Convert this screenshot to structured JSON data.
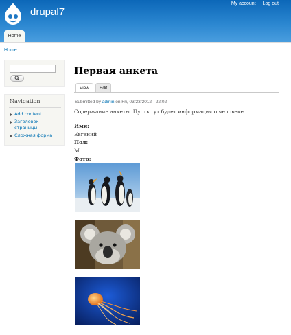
{
  "header": {
    "site_name": "drupal7",
    "secondary_menu": {
      "my_account": "My account",
      "log_out": "Log out"
    },
    "main_menu": {
      "home": "Home"
    },
    "logo_icon": "drupal-drop-icon"
  },
  "breadcrumb": {
    "home": "Home"
  },
  "sidebar": {
    "search": {
      "value": "",
      "button_icon": "magnifier-icon"
    },
    "navigation": {
      "title": "Navigation",
      "items": [
        {
          "label": "Add content"
        },
        {
          "label": "Заголовок страницы"
        },
        {
          "label": "Сложная форма"
        }
      ]
    }
  },
  "node": {
    "title": "Первая анкета",
    "tabs": [
      {
        "label": "View",
        "active": true
      },
      {
        "label": "Edit",
        "active": false
      }
    ],
    "submitted": {
      "prefix": "Submitted by ",
      "author": "admin",
      "suffix": " on Fri, 03/23/2012 - 22:02"
    },
    "body": "Содержание анкеты. Пусть тут будет информация о человеке.",
    "fields": [
      {
        "label": "Имя:",
        "value": "Евгений"
      },
      {
        "label": "Пол:",
        "value": "М"
      },
      {
        "label": "Фото:"
      }
    ],
    "photos": [
      {
        "subject": "penguins"
      },
      {
        "subject": "koala"
      },
      {
        "subject": "jellyfish"
      }
    ]
  },
  "colors": {
    "header_top": "#0c67b8",
    "header_bottom": "#4a9edf",
    "link": "#0071b3",
    "sidebar_bg": "#f6f6f2"
  }
}
